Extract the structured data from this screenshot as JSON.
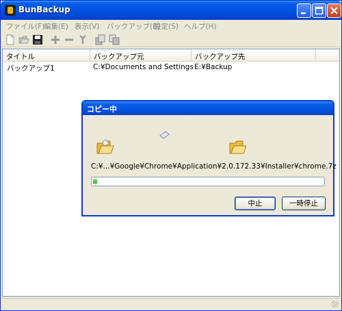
{
  "window": {
    "title": "BunBackup"
  },
  "menu": [
    "ファイル(F)",
    "編集(E)",
    "表示(V)",
    "バックアップ(B)",
    "設定(S)",
    "ヘルプ(H)"
  ],
  "toolbar": {
    "icons": [
      "new-file-icon",
      "open-folder-icon",
      "save-icon",
      "add-icon",
      "remove-icon",
      "settings-icon",
      "backup-icon",
      "restore-icon"
    ]
  },
  "list": {
    "columns": [
      "タイトル",
      "バックアップ元",
      "バックアップ先"
    ],
    "rows": [
      {
        "title": "バックアップ1",
        "source": "C:¥Documents and Settings",
        "dest": "E:¥Backup"
      }
    ]
  },
  "dialog": {
    "title": "コピー中",
    "filepath": "C:¥...¥Google¥Chrome¥Application¥2.0.172.33¥Installer¥chrome.7z",
    "progress": 0.04,
    "buttons": {
      "stop": "中止",
      "pause": "一時停止"
    }
  },
  "colors": {
    "titlebar": "#0055e3",
    "progress": "#2fbd2a",
    "dialog_border": "#0a3cc8"
  }
}
